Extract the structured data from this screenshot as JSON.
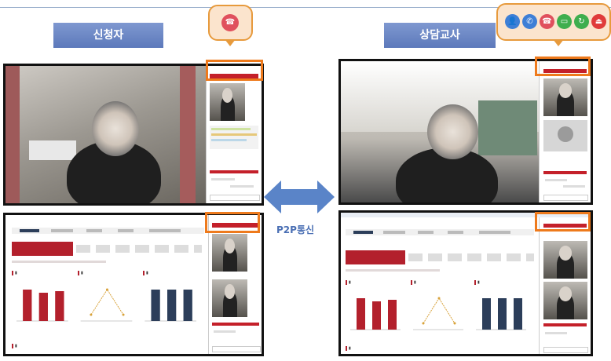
{
  "left_panel": {
    "title": "신청자"
  },
  "right_panel": {
    "title": "상담교사"
  },
  "connection": {
    "label": "P2P통신"
  },
  "colors": {
    "highlight": "#ee7a1c",
    "accent_red": "#c4202a",
    "label_blue": "#5c79bb",
    "arrow_blue": "#5a84c8"
  },
  "left_bubble": {
    "icons": [
      "phone-hangup-icon"
    ]
  },
  "right_bubble": {
    "icons": [
      "user-icon",
      "phone-icon",
      "phone-hangup-icon",
      "screen-share-icon",
      "refresh-icon",
      "exit-icon"
    ]
  },
  "dashboard": {
    "chart_data": [
      {
        "type": "bar",
        "values": [
          20,
          18,
          19
        ]
      },
      {
        "type": "line",
        "values": [
          0.2,
          1.0,
          0.2
        ]
      },
      {
        "type": "bar",
        "values": [
          20,
          20,
          20
        ]
      }
    ]
  }
}
